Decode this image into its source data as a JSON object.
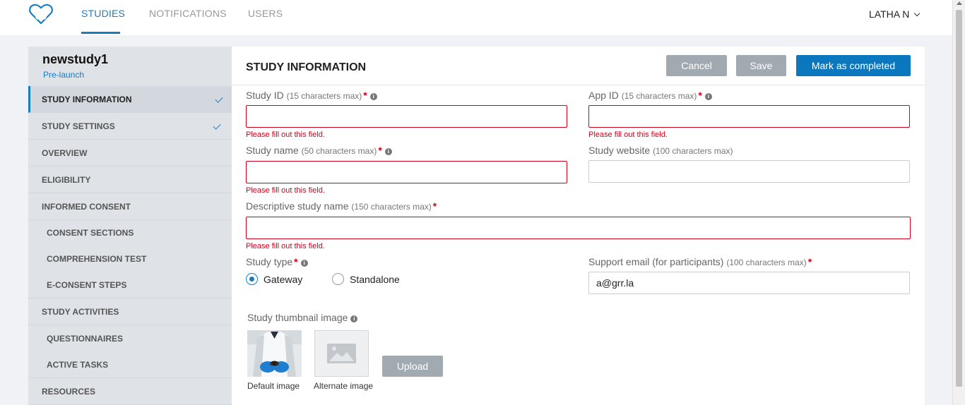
{
  "nav": {
    "tabs": [
      "STUDIES",
      "NOTIFICATIONS",
      "USERS"
    ],
    "user_name": "LATHA N"
  },
  "sidebar": {
    "study_name": "newstudy1",
    "study_status": "Pre-launch",
    "items": [
      {
        "label": "STUDY INFORMATION",
        "completed": true,
        "active": true
      },
      {
        "label": "STUDY SETTINGS",
        "completed": true
      },
      {
        "label": "OVERVIEW"
      },
      {
        "label": "ELIGIBILITY"
      },
      {
        "label": "INFORMED CONSENT"
      },
      {
        "label": "CONSENT SECTIONS"
      },
      {
        "label": "COMPREHENSION TEST"
      },
      {
        "label": "E-CONSENT STEPS"
      },
      {
        "label": "STUDY ACTIVITIES"
      },
      {
        "label": "QUESTIONNAIRES"
      },
      {
        "label": "ACTIVE TASKS"
      },
      {
        "label": "RESOURCES"
      }
    ]
  },
  "main": {
    "title": "STUDY INFORMATION",
    "buttons": {
      "cancel": "Cancel",
      "save": "Save",
      "complete": "Mark as completed"
    },
    "error_text": "Please fill out this field.",
    "fields": {
      "study_id": {
        "label": "Study ID",
        "hint": "(15 characters max)",
        "value": ""
      },
      "app_id": {
        "label": "App ID",
        "hint": "(15 characters max)",
        "value": ""
      },
      "study_name": {
        "label": "Study name",
        "hint": "(50 characters max)",
        "value": ""
      },
      "study_website": {
        "label": "Study website",
        "hint": "(100 characters max)",
        "value": ""
      },
      "descriptive_name": {
        "label": "Descriptive study name",
        "hint": "(150 characters max)",
        "value": ""
      },
      "study_type": {
        "label": "Study type",
        "options": [
          "Gateway",
          "Standalone"
        ],
        "selected": "Gateway"
      },
      "support_email": {
        "label": "Support email (for participants)",
        "hint": "(100 characters max)",
        "value": "a@grr.la"
      }
    },
    "thumbnail": {
      "label": "Study thumbnail image",
      "default_caption": "Default image",
      "alternate_caption": "Alternate image",
      "upload_label": "Upload"
    }
  },
  "colors": {
    "accent": "#1a7bbf",
    "error": "#d0021b",
    "button_grey": "#a1a9b1",
    "button_blue": "#0a77bf"
  }
}
